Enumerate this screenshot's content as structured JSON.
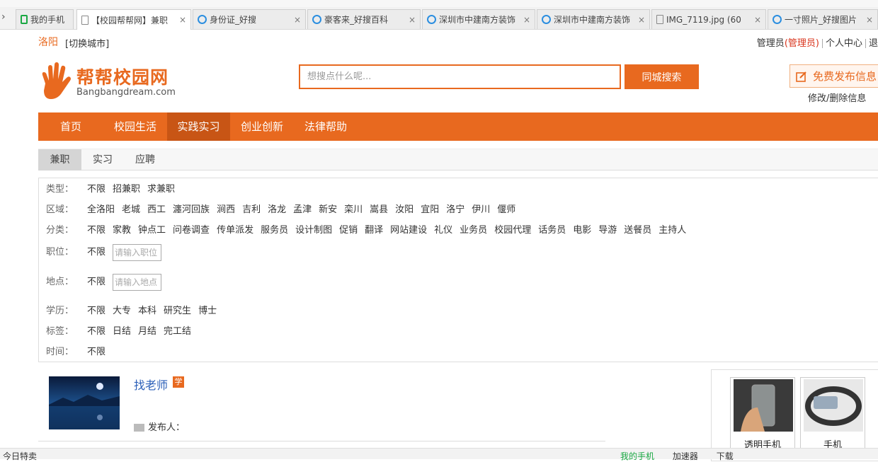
{
  "browser": {
    "tabs": [
      {
        "label": "我的手机",
        "icon": "phone-icon"
      },
      {
        "label": "【校园帮帮网】兼职",
        "icon": "document-icon"
      },
      {
        "label": "身份证_好搜",
        "icon": "search-icon"
      },
      {
        "label": "豪客来_好搜百科",
        "icon": "search-icon"
      },
      {
        "label": "深圳市中建南方装饰",
        "icon": "search-icon"
      },
      {
        "label": "深圳市中建南方装饰",
        "icon": "search-icon"
      },
      {
        "label": "IMG_7119.jpg (60",
        "icon": "document-icon"
      },
      {
        "label": "一寸照片_好搜图片",
        "icon": "search-icon"
      }
    ],
    "close_glyph": "×"
  },
  "topbar": {
    "city": "洛阳",
    "switch_city": "[切换城市]",
    "user": "管理员",
    "role": "(管理员)",
    "personal_center": "个人中心",
    "logout": "退"
  },
  "header": {
    "brand": "帮帮校园网",
    "domain": "Bangbangdream.com",
    "search_placeholder": "想搜点什么呢...",
    "search_button": "同城搜索",
    "publish_button": "免费发布信息",
    "edit_link": "修改/删除信息"
  },
  "nav": {
    "items": [
      "首页",
      "校园生活",
      "实践实习",
      "创业创新",
      "法律帮助"
    ],
    "active_index": 2
  },
  "subtabs": {
    "items": [
      "兼职",
      "实习",
      "应聘"
    ],
    "active_index": 0
  },
  "filters": {
    "type": {
      "label": "类型：",
      "options": [
        "不限",
        "招兼职",
        "求兼职"
      ]
    },
    "area": {
      "label": "区域：",
      "options": [
        "全洛阳",
        "老城",
        "西工",
        "瀍河回族",
        "涧西",
        "吉利",
        "洛龙",
        "孟津",
        "新安",
        "栾川",
        "嵩县",
        "汝阳",
        "宜阳",
        "洛宁",
        "伊川",
        "偃师"
      ]
    },
    "category": {
      "label": "分类：",
      "options": [
        "不限",
        "家教",
        "钟点工",
        "问卷调查",
        "传单派发",
        "服务员",
        "设计制图",
        "促销",
        "翻译",
        "网站建设",
        "礼仪",
        "业务员",
        "校园代理",
        "话务员",
        "电影",
        "导游",
        "送餐员",
        "主持人"
      ]
    },
    "position": {
      "label": "职位：",
      "option": "不限",
      "placeholder": "请输入职位"
    },
    "location": {
      "label": "地点：",
      "option": "不限",
      "placeholder": "请输入地点"
    },
    "education": {
      "label": "学历：",
      "options": [
        "不限",
        "大专",
        "本科",
        "研究生",
        "博士"
      ]
    },
    "tags": {
      "label": "标签：",
      "options": [
        "不限",
        "日结",
        "月结",
        "完工结"
      ]
    },
    "time": {
      "label": "时间：",
      "options": [
        "不限"
      ]
    }
  },
  "listing": {
    "title": "找老师",
    "badge": "学",
    "poster_label": "发布人："
  },
  "sidebar_products": [
    {
      "label": "透明手机"
    },
    {
      "label": "手机"
    }
  ],
  "statusbar": {
    "left": "今日特卖",
    "items": [
      "我的手机",
      "加速器",
      "下载"
    ]
  },
  "colors": {
    "accent": "#e8691f",
    "nav_active": "#c85515",
    "link": "#2b5fb8"
  }
}
